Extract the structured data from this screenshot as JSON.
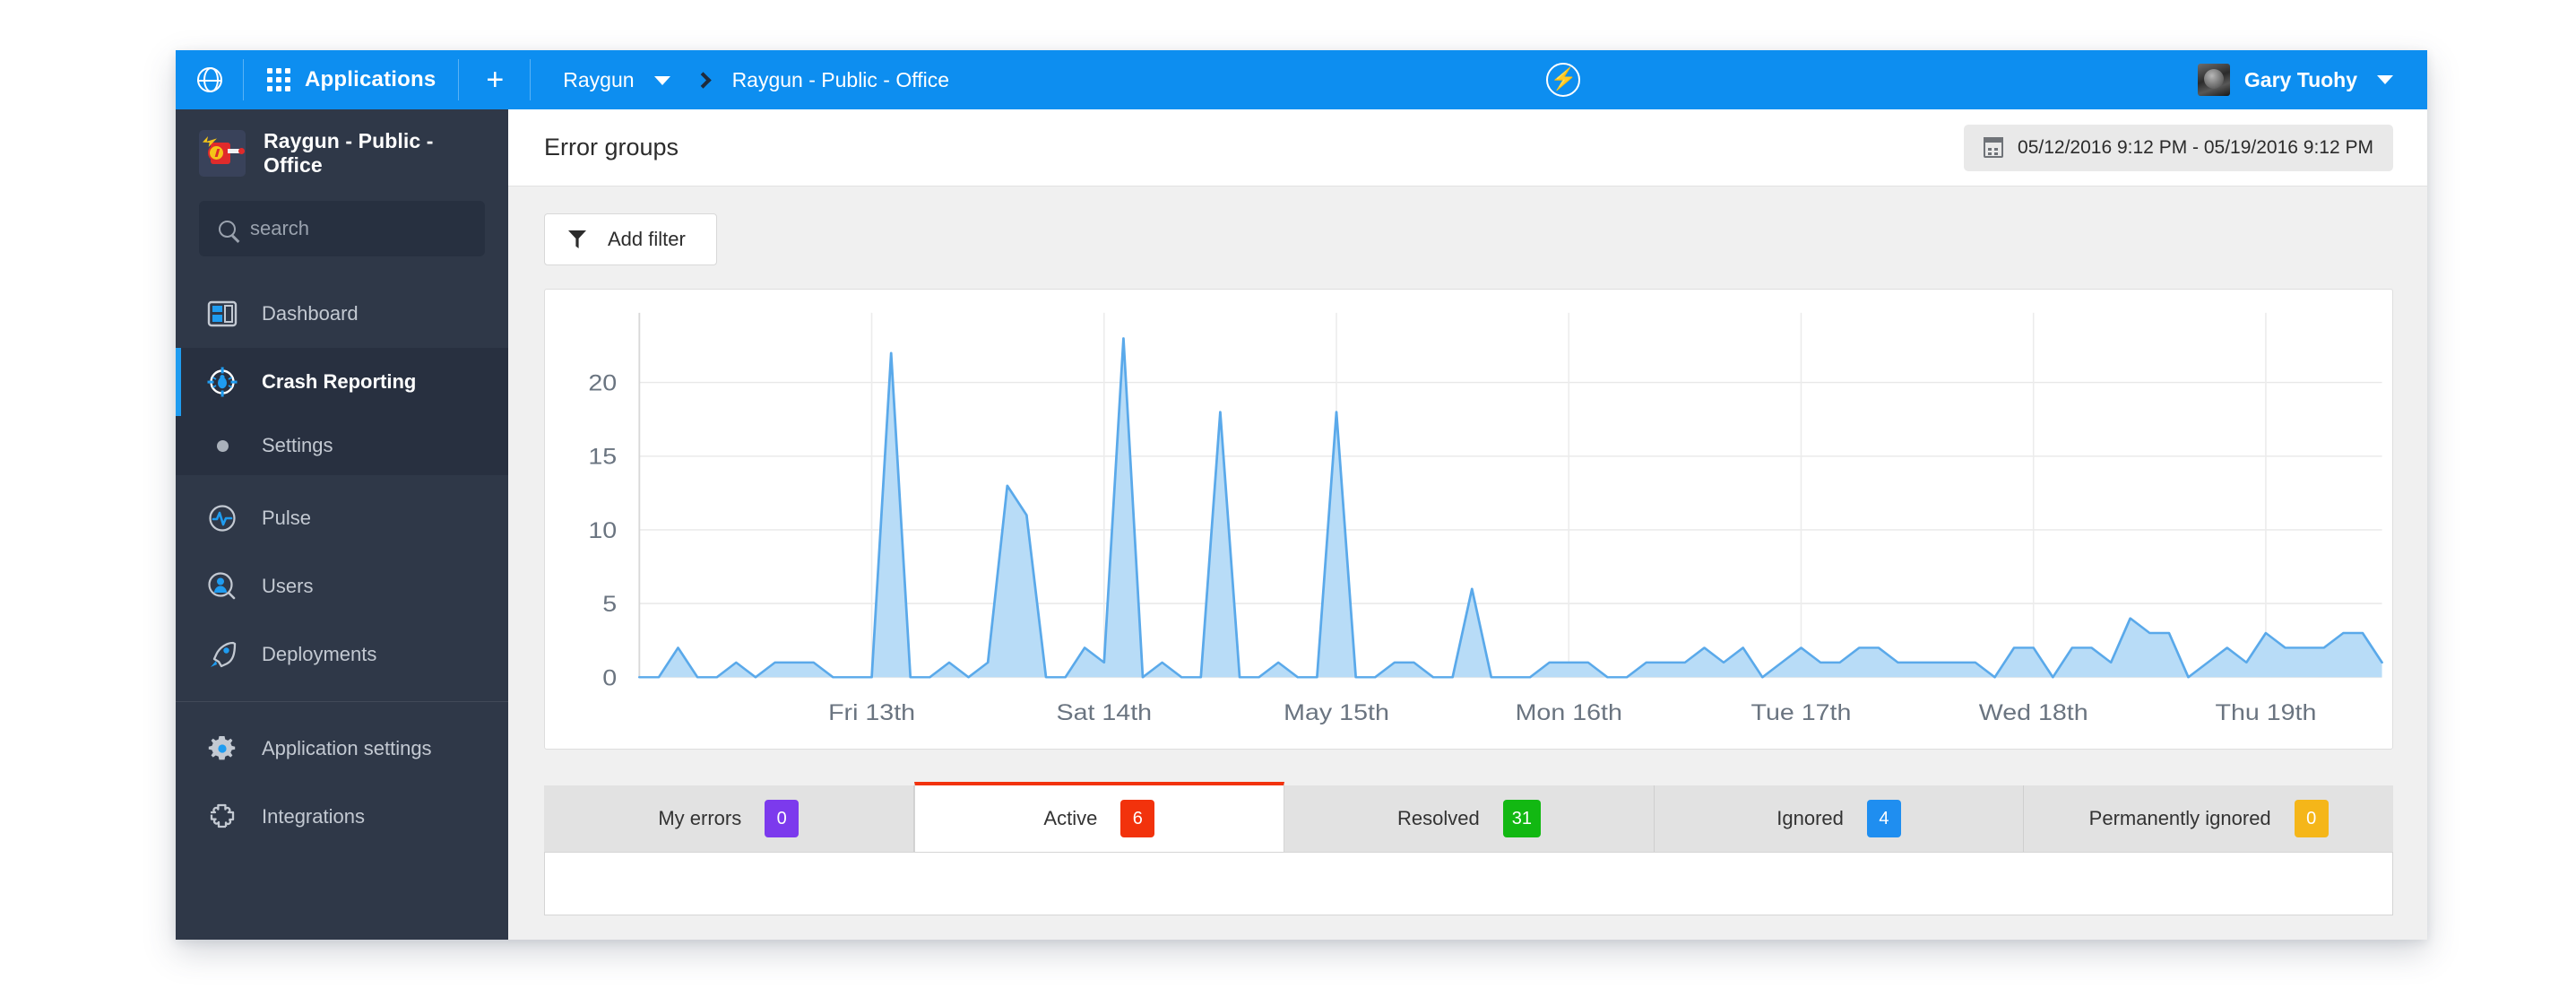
{
  "topbar": {
    "globe_icon": "globe-icon",
    "apps_icon": "grid-icon",
    "apps_label": "Applications",
    "add_label": "+",
    "breadcrumb": {
      "account": "Raygun",
      "separator": "chevron-right-icon",
      "application": "Raygun - Public - Office"
    },
    "center_icon": "bolt-circle-icon",
    "user": {
      "name": "Gary Tuohy",
      "avatar": "user-avatar",
      "caret": "chevron-down-icon"
    },
    "accent_color": "#0d8ef0"
  },
  "sidebar": {
    "app_name": "Raygun - Public - Office",
    "app_logo_icon": "raygun-logo-icon",
    "search": {
      "placeholder": "search",
      "value": "",
      "icon": "search-icon"
    },
    "background_color": "#2f3848",
    "active_accent_color": "#1f9cf0",
    "items": [
      {
        "label": "Dashboard",
        "icon": "dashboard-icon",
        "active": false
      },
      {
        "label": "Crash Reporting",
        "icon": "crosshair-bug-icon",
        "active": true
      },
      {
        "label": "Settings",
        "icon": "dot-icon",
        "active": false,
        "sub": true
      },
      {
        "label": "Pulse",
        "icon": "pulse-icon",
        "active": false
      },
      {
        "label": "Users",
        "icon": "users-search-icon",
        "active": false
      },
      {
        "label": "Deployments",
        "icon": "rocket-icon",
        "active": false
      },
      {
        "label": "Application settings",
        "icon": "gear-icon",
        "active": false
      },
      {
        "label": "Integrations",
        "icon": "puzzle-icon",
        "active": false
      }
    ]
  },
  "content": {
    "page_title": "Error groups",
    "date_range": "05/12/2016 9:12 PM - 05/19/2016 9:12 PM",
    "date_range_icon": "calendar-icon",
    "add_filter_label": "Add filter",
    "add_filter_icon": "funnel-icon"
  },
  "tabs": [
    {
      "label": "My errors",
      "count": "0",
      "color": "#7c3aed",
      "active": false
    },
    {
      "label": "Active",
      "count": "6",
      "color": "#f2320c",
      "active": true
    },
    {
      "label": "Resolved",
      "count": "31",
      "color": "#12b812",
      "active": false
    },
    {
      "label": "Ignored",
      "count": "4",
      "color": "#1f8ef0",
      "active": false
    },
    {
      "label": "Permanently ignored",
      "count": "0",
      "color": "#f5b619",
      "active": false
    }
  ],
  "chart_data": {
    "type": "area",
    "title": "",
    "xlabel": "",
    "ylabel": "",
    "ylim": [
      0,
      24
    ],
    "yticks": [
      0,
      5,
      10,
      15,
      20
    ],
    "grid": true,
    "legend": "none",
    "line_color": "#5aa9ea",
    "fill_color": "#b8dcf7",
    "xtick_labels": [
      "Fri 13th",
      "Sat 14th",
      "May 15th",
      "Mon 16th",
      "Tue 17th",
      "Wed 18th",
      "Thu 19th"
    ],
    "xtick_positions": [
      12,
      24,
      36,
      48,
      60,
      72,
      84
    ],
    "x": [
      0,
      1,
      2,
      3,
      4,
      5,
      6,
      7,
      8,
      9,
      10,
      11,
      12,
      13,
      14,
      15,
      16,
      17,
      18,
      19,
      20,
      21,
      22,
      23,
      24,
      25,
      26,
      27,
      28,
      29,
      30,
      31,
      32,
      33,
      34,
      35,
      36,
      37,
      38,
      39,
      40,
      41,
      42,
      43,
      44,
      45,
      46,
      47,
      48,
      49,
      50,
      51,
      52,
      53,
      54,
      55,
      56,
      57,
      58,
      59,
      60,
      61,
      62,
      63,
      64,
      65,
      66,
      67,
      68,
      69,
      70,
      71,
      72,
      73,
      74,
      75,
      76,
      77,
      78,
      79,
      80,
      81,
      82,
      83,
      84,
      85,
      86,
      87,
      88,
      89,
      90
    ],
    "values": [
      0,
      0,
      2,
      0,
      0,
      1,
      0,
      1,
      1,
      1,
      0,
      0,
      0,
      22,
      0,
      0,
      1,
      0,
      1,
      13,
      11,
      0,
      0,
      2,
      1,
      23,
      0,
      1,
      0,
      0,
      18,
      0,
      0,
      1,
      0,
      0,
      18,
      0,
      0,
      1,
      1,
      0,
      0,
      6,
      0,
      0,
      0,
      1,
      1,
      1,
      0,
      0,
      1,
      1,
      1,
      2,
      1,
      2,
      0,
      1,
      2,
      1,
      1,
      2,
      2,
      1,
      1,
      1,
      1,
      1,
      0,
      2,
      2,
      0,
      2,
      2,
      1,
      4,
      3,
      3,
      0,
      1,
      2,
      1,
      3,
      2,
      2,
      2,
      3,
      3,
      1
    ]
  }
}
